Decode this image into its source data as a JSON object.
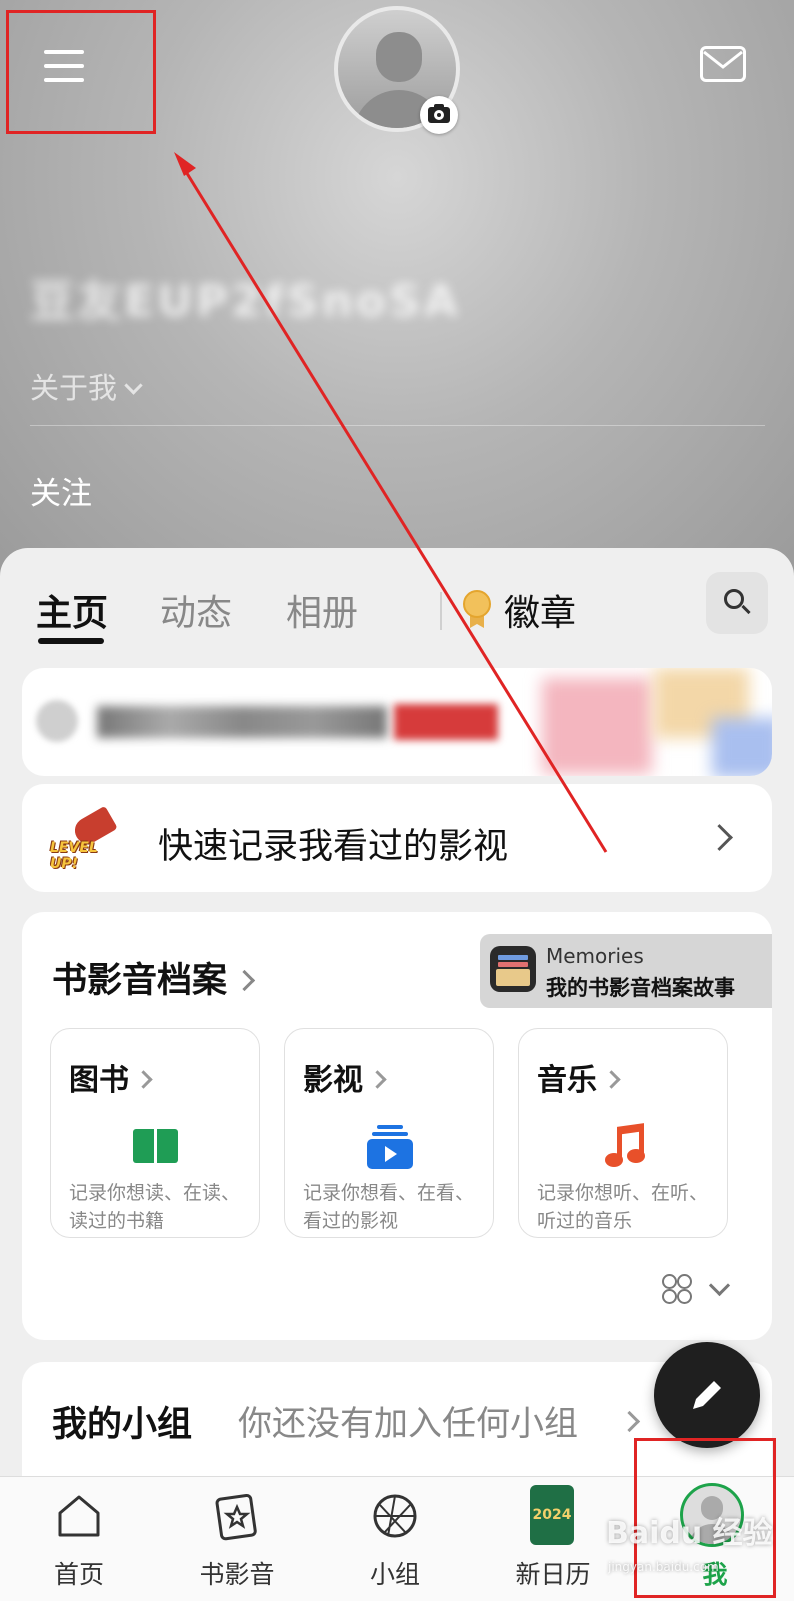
{
  "header": {
    "username": "豆友EUP2fSnoSA",
    "about_label": "关于我",
    "follow_label": "关注"
  },
  "tabs": [
    {
      "label": "主页",
      "active": true
    },
    {
      "label": "动态",
      "active": false
    },
    {
      "label": "相册",
      "active": false
    },
    {
      "label": "徽章",
      "active": false
    }
  ],
  "quick_record": {
    "text": "快速记录我看过的影视",
    "badge_text": "LEVEL UP!"
  },
  "archive": {
    "title": "书影音档案",
    "memories_line1": "Memories",
    "memories_line2": "我的书影音档案故事",
    "cards": [
      {
        "title": "图书",
        "desc": "记录你想读、在读、读过的书籍",
        "icon": "book-icon"
      },
      {
        "title": "影视",
        "desc": "记录你想看、在看、看过的影视",
        "icon": "video-icon"
      },
      {
        "title": "音乐",
        "desc": "记录你想听、在听、听过的音乐",
        "icon": "music-icon"
      }
    ]
  },
  "groups": {
    "title": "我的小组",
    "subtitle": "你还没有加入任何小组"
  },
  "tabbar": [
    {
      "label": "首页",
      "icon": "home-icon"
    },
    {
      "label": "书影音",
      "icon": "star-card-icon"
    },
    {
      "label": "小组",
      "icon": "globe-icon"
    },
    {
      "label": "新日历",
      "icon": "calendar-icon",
      "year": "2024"
    },
    {
      "label": "我",
      "icon": "avatar",
      "active": true
    }
  ],
  "watermark": {
    "text": "Baidu 经验",
    "url": "jingyan.baidu.com"
  },
  "colors": {
    "accent_green": "#1da34a",
    "annotation_red": "#e02424"
  }
}
